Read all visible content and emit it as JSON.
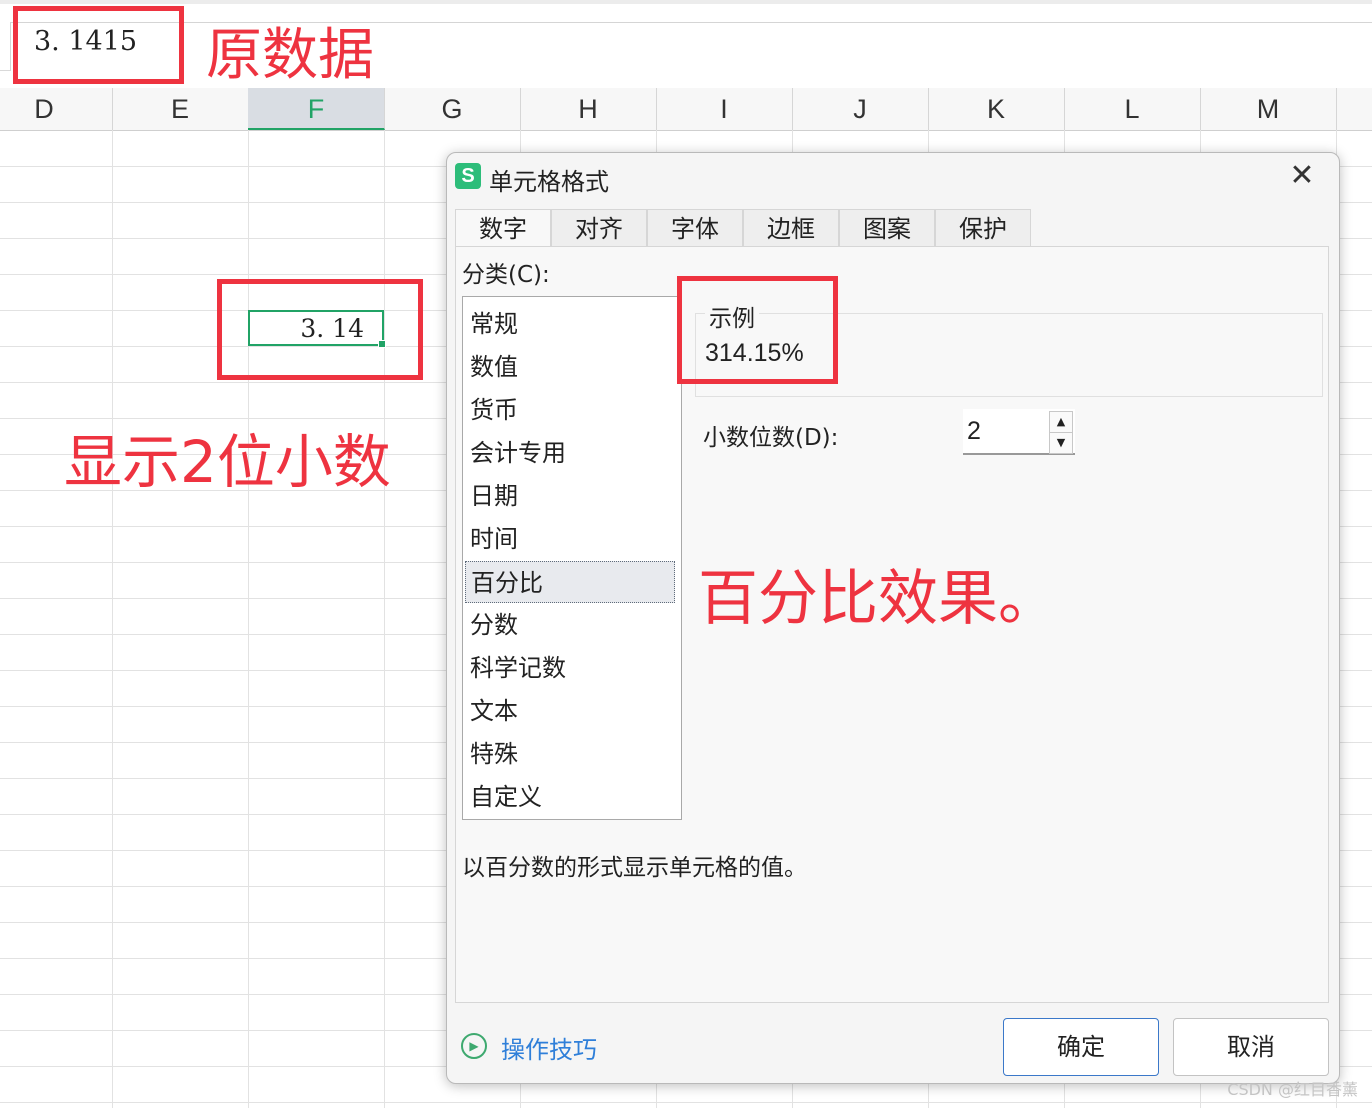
{
  "formula_bar": {
    "value": "3. 1415"
  },
  "columns": [
    "D",
    "E",
    "F",
    "G",
    "H",
    "I",
    "J",
    "K",
    "L",
    "M"
  ],
  "active_column": "F",
  "cell": {
    "value": "3. 14"
  },
  "annotations": {
    "original_data": "原数据",
    "two_decimals": "显示2位小数",
    "percent_effect": "百分比效果。",
    "color": "#ee3340"
  },
  "dialog": {
    "title": "单元格格式",
    "logo": "S",
    "close_icon": "✕",
    "tabs": [
      "数字",
      "对齐",
      "字体",
      "边框",
      "图案",
      "保护"
    ],
    "active_tab": "数字",
    "category_label": "分类(C):",
    "categories": [
      "常规",
      "数值",
      "货币",
      "会计专用",
      "日期",
      "时间",
      "百分比",
      "分数",
      "科学记数",
      "文本",
      "特殊",
      "自定义"
    ],
    "selected_category": "百分比",
    "sample": {
      "legend": "示例",
      "value": "314.15%"
    },
    "decimal_places": {
      "label": "小数位数(D):",
      "value": "2"
    },
    "description": "以百分数的形式显示单元格的值。",
    "tips_link": "操作技巧",
    "ok": "确定",
    "cancel": "取消"
  },
  "accent_color": "#21a366",
  "watermark": "CSDN @红目香薰"
}
